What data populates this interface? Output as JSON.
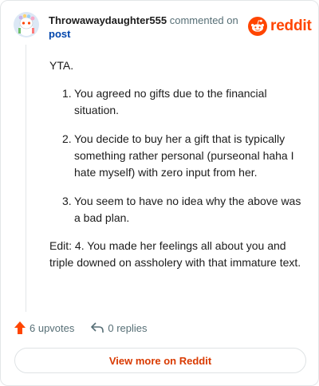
{
  "header": {
    "author": "Throwawaydaughter555",
    "commented_text": "commented on",
    "post_link": "post"
  },
  "brand": {
    "wordmark": "reddit",
    "color": "#ff4500",
    "icon": "reddit-snoo-icon"
  },
  "comment": {
    "intro": "YTA.",
    "items": [
      {
        "number": "1.",
        "text": "You agreed no gifts due to the financial situation."
      },
      {
        "number": "2.",
        "text": "You decide to buy her a gift that is typically something rather personal (purseonal haha I hate myself) with zero input from her."
      },
      {
        "number": "3.",
        "text": "You seem to have no idea why the above was a bad plan."
      }
    ],
    "edit": "Edit: 4. You made her feelings all about you and triple downed on assholery with that immature text."
  },
  "actions": {
    "upvotes": "6 upvotes",
    "replies": "0 replies",
    "upvote_icon": "upvote-arrow-icon",
    "reply_icon": "reply-arrow-icon"
  },
  "cta": {
    "label": "View more on Reddit"
  },
  "colors": {
    "accent": "#d93a00",
    "link": "#0045ac",
    "muted": "#576f76",
    "border": "#e3e6e8"
  }
}
